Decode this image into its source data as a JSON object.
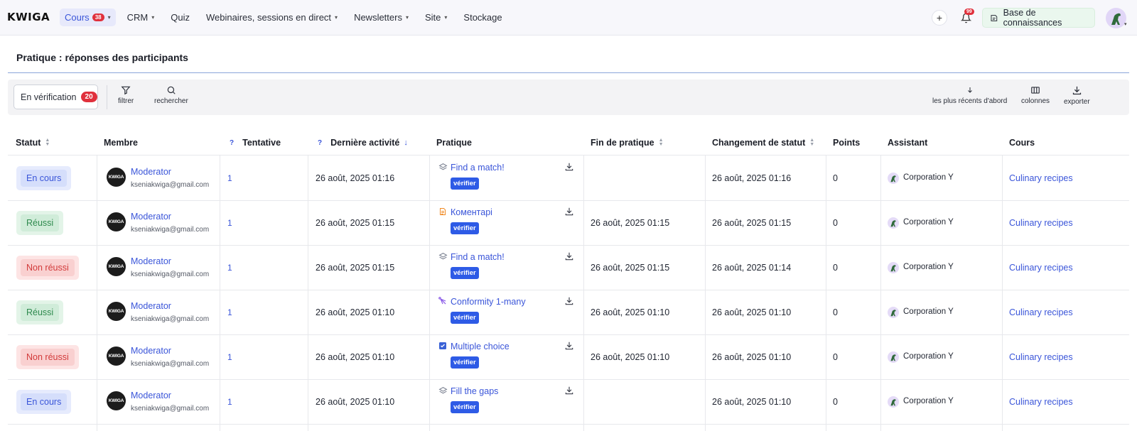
{
  "nav": {
    "logo": "KWIGA",
    "items": [
      {
        "label": "Cours",
        "badge": "38",
        "active": true,
        "dropdown": true
      },
      {
        "label": "CRM",
        "dropdown": true
      },
      {
        "label": "Quiz",
        "dropdown": false
      },
      {
        "label": "Webinaires, sessions en direct",
        "dropdown": true
      },
      {
        "label": "Newsletters",
        "dropdown": true
      },
      {
        "label": "Site",
        "dropdown": true
      },
      {
        "label": "Stockage",
        "dropdown": false
      }
    ],
    "plus_label": "+",
    "notifications_count": "99",
    "knowledge_base_label": "Base de connaissances"
  },
  "page": {
    "title": "Pratique : réponses des participants"
  },
  "toolbar": {
    "status_filter": "En vérification",
    "status_count": "20",
    "filter_label": "filtrer",
    "search_label": "rechercher",
    "sort_label": "les plus récents d'abord",
    "columns_label": "colonnes",
    "export_label": "exporter"
  },
  "table": {
    "headers": {
      "status": "Statut",
      "member": "Membre",
      "attempt_help": "?",
      "attempt": "Tentative",
      "activity_help": "?",
      "last_activity": "Dernière activité",
      "practice": "Pratique",
      "practice_end": "Fin de pratique",
      "status_change": "Changement de statut",
      "points": "Points",
      "assistant": "Assistant",
      "course": "Cours"
    },
    "verify_label": "vérifier",
    "avatar_text": "KWIGA",
    "rows": [
      {
        "status": "En cours",
        "status_type": "progress",
        "member": "Moderator",
        "email": "kseniakwiga@gmail.com",
        "attempt": "1",
        "last_activity": "26 août, 2025 01:16",
        "practice": "Find a match!",
        "practice_icon": "layers-icon",
        "practice_end": "",
        "status_change": "26 août, 2025 01:16",
        "points": "0",
        "assistant": "Corporation Y",
        "course": "Culinary recipes"
      },
      {
        "status": "Réussi",
        "status_type": "success",
        "member": "Moderator",
        "email": "kseniakwiga@gmail.com",
        "attempt": "1",
        "last_activity": "26 août, 2025 01:15",
        "practice": "Коментарі",
        "practice_icon": "document-icon",
        "practice_end": "26 août, 2025 01:15",
        "status_change": "26 août, 2025 01:15",
        "points": "0",
        "assistant": "Corporation Y",
        "course": "Culinary recipes"
      },
      {
        "status": "Non réussi",
        "status_type": "fail",
        "member": "Moderator",
        "email": "kseniakwiga@gmail.com",
        "attempt": "1",
        "last_activity": "26 août, 2025 01:15",
        "practice": "Find a match!",
        "practice_icon": "layers-icon",
        "practice_end": "26 août, 2025 01:15",
        "status_change": "26 août, 2025 01:14",
        "points": "0",
        "assistant": "Corporation Y",
        "course": "Culinary recipes"
      },
      {
        "status": "Réussi",
        "status_type": "success",
        "member": "Moderator",
        "email": "kseniakwiga@gmail.com",
        "attempt": "1",
        "last_activity": "26 août, 2025 01:10",
        "practice": "Conformity 1-many",
        "practice_icon": "conformity-icon",
        "practice_end": "26 août, 2025 01:10",
        "status_change": "26 août, 2025 01:10",
        "points": "0",
        "assistant": "Corporation Y",
        "course": "Culinary recipes"
      },
      {
        "status": "Non réussi",
        "status_type": "fail",
        "member": "Moderator",
        "email": "kseniakwiga@gmail.com",
        "attempt": "1",
        "last_activity": "26 août, 2025 01:10",
        "practice": "Multiple choice",
        "practice_icon": "checkbox-icon",
        "practice_end": "26 août, 2025 01:10",
        "status_change": "26 août, 2025 01:10",
        "points": "0",
        "assistant": "Corporation Y",
        "course": "Culinary recipes"
      },
      {
        "status": "En cours",
        "status_type": "progress",
        "member": "Moderator",
        "email": "kseniakwiga@gmail.com",
        "attempt": "1",
        "last_activity": "26 août, 2025 01:10",
        "practice": "Fill the gaps",
        "practice_icon": "layers-icon",
        "practice_end": "",
        "status_change": "26 août, 2025 01:10",
        "points": "0",
        "assistant": "Corporation Y",
        "course": "Culinary recipes"
      }
    ]
  }
}
